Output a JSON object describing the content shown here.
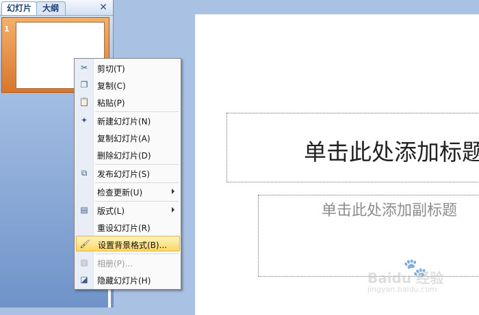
{
  "slides_pane": {
    "tab_slides": "幻灯片",
    "tab_outline": "大纲",
    "close_glyph": "✕",
    "slide_number": "1"
  },
  "slide": {
    "title_placeholder": "单击此处添加标题",
    "subtitle_placeholder": "单击此处添加副标题"
  },
  "context_menu": {
    "items": [
      {
        "label": "剪切(T)",
        "icon": "scissors-icon",
        "glyph": "✂"
      },
      {
        "label": "复制(C)",
        "icon": "copy-icon",
        "glyph": "❐"
      },
      {
        "label": "粘贴(P)",
        "icon": "paste-icon",
        "glyph": "📋"
      },
      {
        "label": "新建幻灯片(N)",
        "icon": "new-slide-icon",
        "glyph": "✦"
      },
      {
        "label": "复制幻灯片(A)",
        "icon": "",
        "glyph": ""
      },
      {
        "label": "删除幻灯片(D)",
        "icon": "",
        "glyph": ""
      },
      {
        "label": "发布幻灯片(S)",
        "icon": "publish-slides-icon",
        "glyph": "⧉"
      },
      {
        "label": "检查更新(U)",
        "icon": "",
        "glyph": "",
        "submenu": true
      },
      {
        "label": "版式(L)",
        "icon": "layout-icon",
        "glyph": "▤",
        "submenu": true
      },
      {
        "label": "重设幻灯片(R)",
        "icon": "",
        "glyph": ""
      },
      {
        "label": "设置背景格式(B)...",
        "icon": "format-background-icon",
        "glyph": "🖌",
        "highlighted": true
      },
      {
        "label": "相册(P)...",
        "icon": "photo-album-icon",
        "glyph": "▨",
        "disabled": true
      },
      {
        "label": "隐藏幻灯片(H)",
        "icon": "hide-slide-icon",
        "glyph": "◪"
      }
    ]
  },
  "watermark": {
    "brand": "Baidu 经验",
    "site": "jingyan.baidu.com"
  },
  "colors": {
    "selection_orange": "#e08a3c",
    "menu_highlight": "#fed765",
    "pane_blue": "#6f93c8"
  }
}
